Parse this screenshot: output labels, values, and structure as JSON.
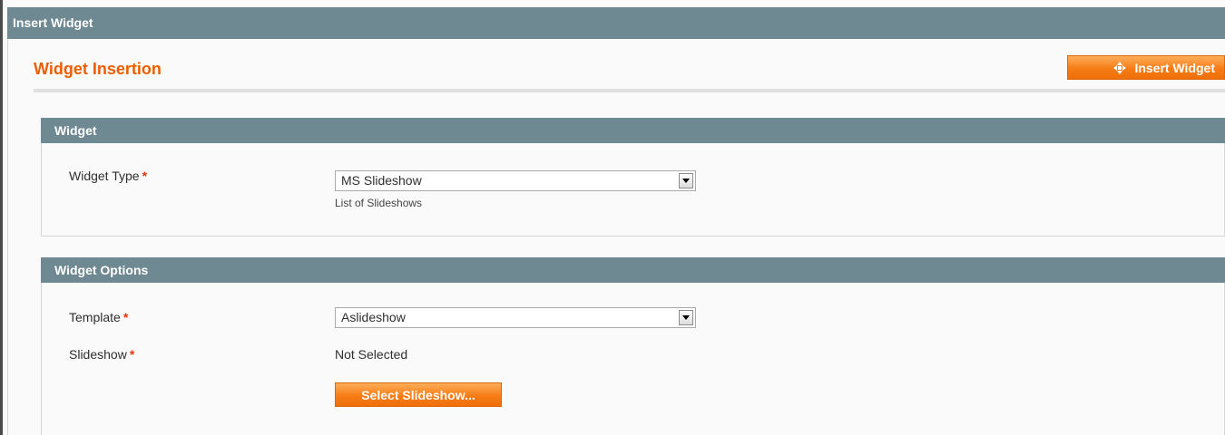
{
  "window": {
    "title": "Insert Widget"
  },
  "page": {
    "title": "Widget Insertion",
    "insert_button_label": "Insert Widget"
  },
  "widget_section": {
    "header": "Widget",
    "widget_type": {
      "label": "Widget Type",
      "required_mark": "*",
      "selected": "MS Slideshow",
      "note": "List of Slideshows"
    }
  },
  "options_section": {
    "header": "Widget Options",
    "template": {
      "label": "Template",
      "required_mark": "*",
      "selected": "Aslideshow"
    },
    "slideshow": {
      "label": "Slideshow",
      "required_mark": "*",
      "value": "Not Selected",
      "button_label": "Select Slideshow..."
    }
  },
  "colors": {
    "header_bar": "#6f8992",
    "accent_orange": "#eb5e00",
    "button_orange": "#f77c16",
    "required_red": "#eb340a"
  },
  "icons": {
    "insert_button_icon": "insert-widget-icon",
    "dropdown_icon": "chevron-down-icon"
  }
}
